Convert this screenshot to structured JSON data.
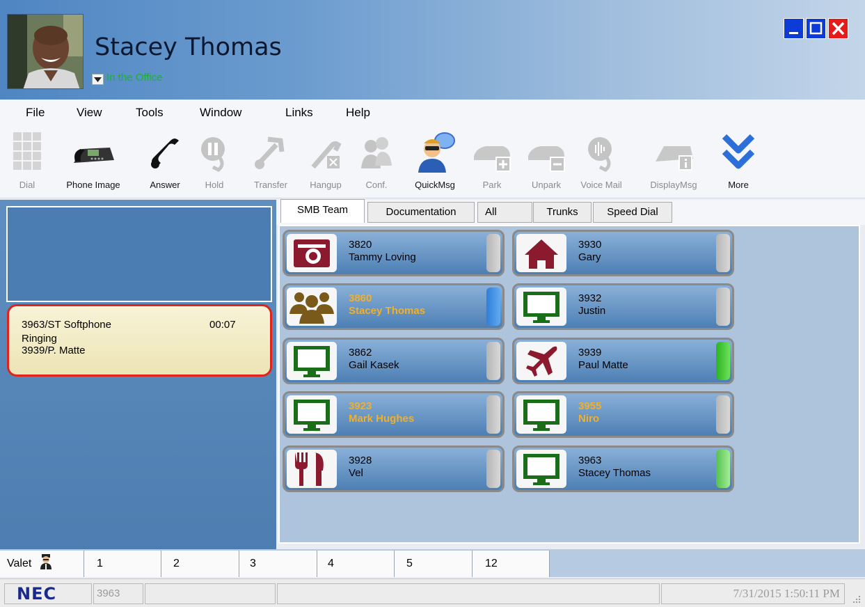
{
  "user": {
    "name": "Stacey Thomas",
    "status": "In the Office"
  },
  "menu": [
    "File",
    "View",
    "Tools",
    "Window",
    "Links",
    "Help"
  ],
  "toolbar": {
    "dial": "Dial",
    "phone_image": "Phone Image",
    "answer": "Answer",
    "hold": "Hold",
    "transfer": "Transfer",
    "hangup": "Hangup",
    "conf": "Conf.",
    "quickmsg": "QuickMsg",
    "park": "Park",
    "unpark": "Unpark",
    "voice_mail": "Voice Mail",
    "displaymsg": "DisplayMsg",
    "more": "More"
  },
  "call": {
    "line": "3963/ST Softphone",
    "timer": "00:07",
    "state": "Ringing",
    "party": "3939/P. Matte"
  },
  "tabs": [
    "SMB Team",
    "Documentation",
    "All",
    "Trunks",
    "Speed Dial"
  ],
  "contacts": [
    {
      "ext": "3820",
      "name": "Tammy Loving",
      "icon": "camera-icon",
      "status": "idle"
    },
    {
      "ext": "3930",
      "name": "Gary",
      "icon": "home-icon",
      "status": "idle"
    },
    {
      "ext": "3860",
      "name": "Stacey Thomas",
      "icon": "group-icon",
      "status": "busy-self"
    },
    {
      "ext": "3932",
      "name": "Justin",
      "icon": "monitor-icon",
      "status": "idle"
    },
    {
      "ext": "3862",
      "name": "Gail Kasek",
      "icon": "monitor-icon",
      "status": "idle"
    },
    {
      "ext": "3939",
      "name": "Paul Matte",
      "icon": "airplane-icon",
      "status": "ringing"
    },
    {
      "ext": "3923",
      "name": "Mark Hughes",
      "icon": "monitor-icon",
      "status": "busy"
    },
    {
      "ext": "3955",
      "name": "Niro",
      "icon": "monitor-icon",
      "status": "busy"
    },
    {
      "ext": "3928",
      "name": "Vel",
      "icon": "food-icon",
      "status": "idle"
    },
    {
      "ext": "3963",
      "name": "Stacey Thomas",
      "icon": "monitor-icon",
      "status": "ringing-self"
    }
  ],
  "park": {
    "valet": "Valet",
    "slots": [
      "1",
      "2",
      "3",
      "4",
      "5",
      "12"
    ]
  },
  "statusbar": {
    "brand": "NEC",
    "extension": "3963",
    "datetime": "7/31/2015 1:50:11 PM"
  },
  "colors": {
    "header_blue": "#4f86c2",
    "status_green": "#1bb134",
    "busy_text": "#f0b02a",
    "ringing_border": "#e0231b"
  }
}
